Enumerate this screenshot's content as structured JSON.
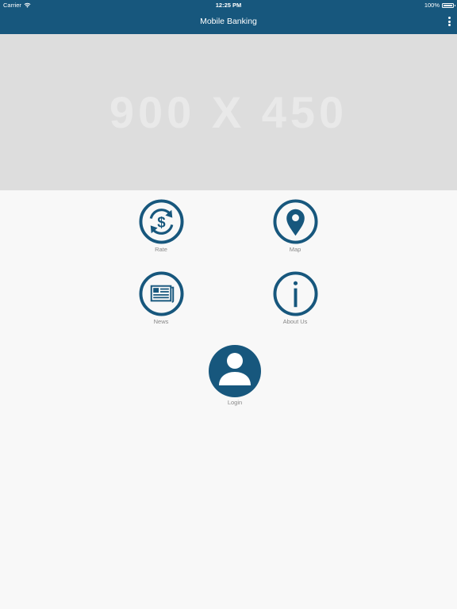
{
  "status_bar": {
    "carrier": "Carrier",
    "time": "12:25 PM",
    "battery": "100%"
  },
  "header": {
    "title": "Mobile Banking",
    "menu_icon": "more-vertical-icon"
  },
  "banner": {
    "text": "900 X 450"
  },
  "menu_items": [
    {
      "label": "Rate",
      "icon": "currency-exchange-icon"
    },
    {
      "label": "Map",
      "icon": "map-pin-icon"
    },
    {
      "label": "News",
      "icon": "newspaper-icon"
    },
    {
      "label": "About Us",
      "icon": "info-icon"
    },
    {
      "label": "Login",
      "icon": "user-icon"
    }
  ],
  "colors": {
    "primary": "#17577d",
    "background": "#f8f8f8",
    "banner": "#dddddd"
  }
}
